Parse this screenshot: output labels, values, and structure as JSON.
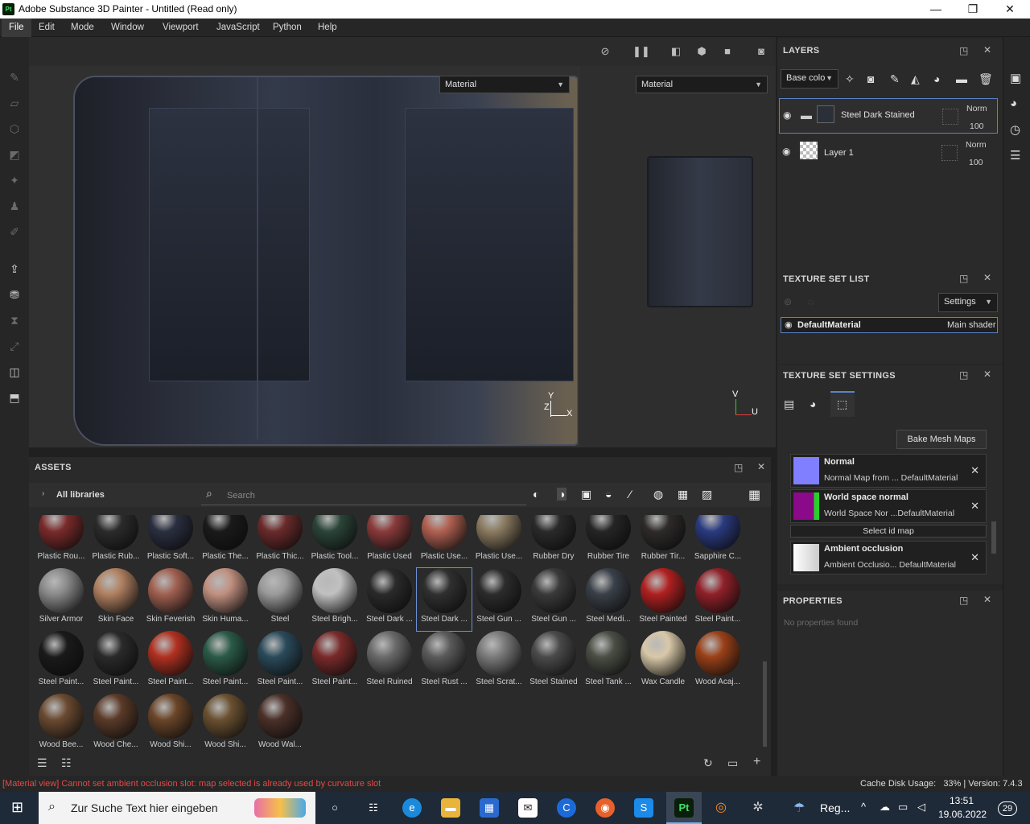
{
  "window": {
    "app_icon_label": "Pt",
    "title": "Adobe Substance 3D Painter - Untitled (Read only)",
    "minimize_glyph": "—",
    "restore_glyph": "❐",
    "close_glyph": "✕"
  },
  "menu": [
    "File",
    "Edit",
    "Mode",
    "Window",
    "Viewport",
    "JavaScript",
    "Python",
    "Help"
  ],
  "viewport": {
    "left_dropdown": "Material",
    "right_dropdown": "Material",
    "axis_left": {
      "y": "Y",
      "z": "Z",
      "x": "X"
    },
    "axis_right": {
      "v": "V",
      "u": "U"
    }
  },
  "layers": {
    "title": "LAYERS",
    "channel_dropdown": "Base colo",
    "items": [
      {
        "name": "Steel Dark Stained",
        "blend": "Norm",
        "opacity": "100",
        "type": "folder",
        "selected": true
      },
      {
        "name": "Layer 1",
        "blend": "Norm",
        "opacity": "100",
        "type": "fill",
        "selected": false
      }
    ]
  },
  "texture_set_list": {
    "title": "TEXTURE SET LIST",
    "settings_label": "Settings",
    "material": "DefaultMaterial",
    "shader": "Main shader"
  },
  "texture_set_settings": {
    "title": "TEXTURE SET SETTINGS",
    "bake_button": "Bake Mesh Maps",
    "select_id_map": "Select id map",
    "maps": [
      {
        "title": "Normal",
        "subtitle": "Normal Map from ... DefaultMaterial",
        "color": "#7f7fff"
      },
      {
        "title": "World space normal",
        "subtitle": "World Space Nor ...DefaultMaterial",
        "color": "#8a0a8a"
      },
      {
        "title": "Ambient occlusion",
        "subtitle": "Ambient Occlusio... DefaultMaterial",
        "color": "#e8e8e8"
      }
    ]
  },
  "properties": {
    "title": "PROPERTIES",
    "empty_text": "No properties found"
  },
  "assets": {
    "title": "ASSETS",
    "breadcrumb": "All libraries",
    "search_placeholder": "Search",
    "rows": [
      [
        {
          "label": "Plastic Rou...",
          "color": "#7a2a2a"
        },
        {
          "label": "Plastic Rub...",
          "color": "#2b2b2b"
        },
        {
          "label": "Plastic Soft...",
          "color": "#2a2f40"
        },
        {
          "label": "Plastic The...",
          "color": "#1a1a1a"
        },
        {
          "label": "Plastic Thic...",
          "color": "#6a2a2a"
        },
        {
          "label": "Plastic Tool...",
          "color": "#2a4438"
        },
        {
          "label": "Plastic Used",
          "color": "#8a3a3a"
        },
        {
          "label": "Plastic Use...",
          "color": "#b06050"
        },
        {
          "label": "Plastic Use...",
          "color": "#8a7a60"
        },
        {
          "label": "Rubber Dry",
          "color": "#2a2a2a"
        },
        {
          "label": "Rubber Tire",
          "color": "#252525"
        },
        {
          "label": "Rubber Tir...",
          "color": "#2e2a2a"
        },
        {
          "label": "Sapphire C...",
          "color": "#2a3a80"
        }
      ],
      [
        {
          "label": "Silver Armor",
          "color": "#8a8a8a"
        },
        {
          "label": "Skin Face",
          "color": "#b08060"
        },
        {
          "label": "Skin Feverish",
          "color": "#a06050"
        },
        {
          "label": "Skin Huma...",
          "color": "#c09080"
        },
        {
          "label": "Steel",
          "color": "#9a9a9a"
        },
        {
          "label": "Steel Brigh...",
          "color": "#c0c0c0"
        },
        {
          "label": "Steel Dark ...",
          "color": "#2a2a2a"
        },
        {
          "label": "Steel Dark ...",
          "color": "#303030",
          "selected": true
        },
        {
          "label": "Steel Gun ...",
          "color": "#2c2c2c"
        },
        {
          "label": "Steel Gun ...",
          "color": "#3a3a3a"
        },
        {
          "label": "Steel Medi...",
          "color": "#3a4048"
        },
        {
          "label": "Steel Painted",
          "color": "#b02020"
        },
        {
          "label": "Steel Paint...",
          "color": "#902028"
        }
      ],
      [
        {
          "label": "Steel Paint...",
          "color": "#1a1a1a"
        },
        {
          "label": "Steel Paint...",
          "color": "#2a2a2a"
        },
        {
          "label": "Steel Paint...",
          "color": "#b03020"
        },
        {
          "label": "Steel Paint...",
          "color": "#2a5a48"
        },
        {
          "label": "Steel Paint...",
          "color": "#2a4a5a"
        },
        {
          "label": "Steel Paint...",
          "color": "#7a2a2a"
        },
        {
          "label": "Steel Ruined",
          "color": "#6a6a6a"
        },
        {
          "label": "Steel Rust ...",
          "color": "#5a5a5a"
        },
        {
          "label": "Steel Scrat...",
          "color": "#7a7a7a"
        },
        {
          "label": "Steel Stained",
          "color": "#4a4a4a"
        },
        {
          "label": "Steel Tank ...",
          "color": "#4a4e44"
        },
        {
          "label": "Wax Candle",
          "color": "#d8c8a8"
        },
        {
          "label": "Wood Acaj...",
          "color": "#9a4018"
        }
      ],
      [
        {
          "label": "Wood Bee...",
          "color": "#6a4a30"
        },
        {
          "label": "Wood Che...",
          "color": "#5a3a28"
        },
        {
          "label": "Wood Shi...",
          "color": "#6a4528"
        },
        {
          "label": "Wood Shi...",
          "color": "#6a5030"
        },
        {
          "label": "Wood Wal...",
          "color": "#4a3028"
        }
      ]
    ]
  },
  "status": {
    "message": "[Material view] Cannot set ambient occlusion slot: map selected is already used by curvature slot",
    "right": "Cache Disk Usage:   33% | Version: 7.4.3",
    "error_color": "#e04a4a"
  },
  "taskbar": {
    "search_placeholder": "Zur Suche Text hier eingeben",
    "weather_text": "Reg...",
    "time": "13:51",
    "date": "19.06.2022",
    "notifications": "29"
  }
}
